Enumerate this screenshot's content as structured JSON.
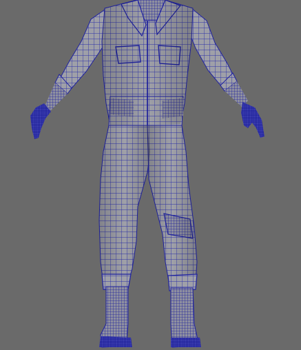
{
  "viewport": {
    "background": "#6a6a6a",
    "mesh_fill": "#9fa0a8",
    "mesh_shadow": "#7c7d86",
    "wire_color": "#1f22a0",
    "wire_dense": "#15179a"
  }
}
